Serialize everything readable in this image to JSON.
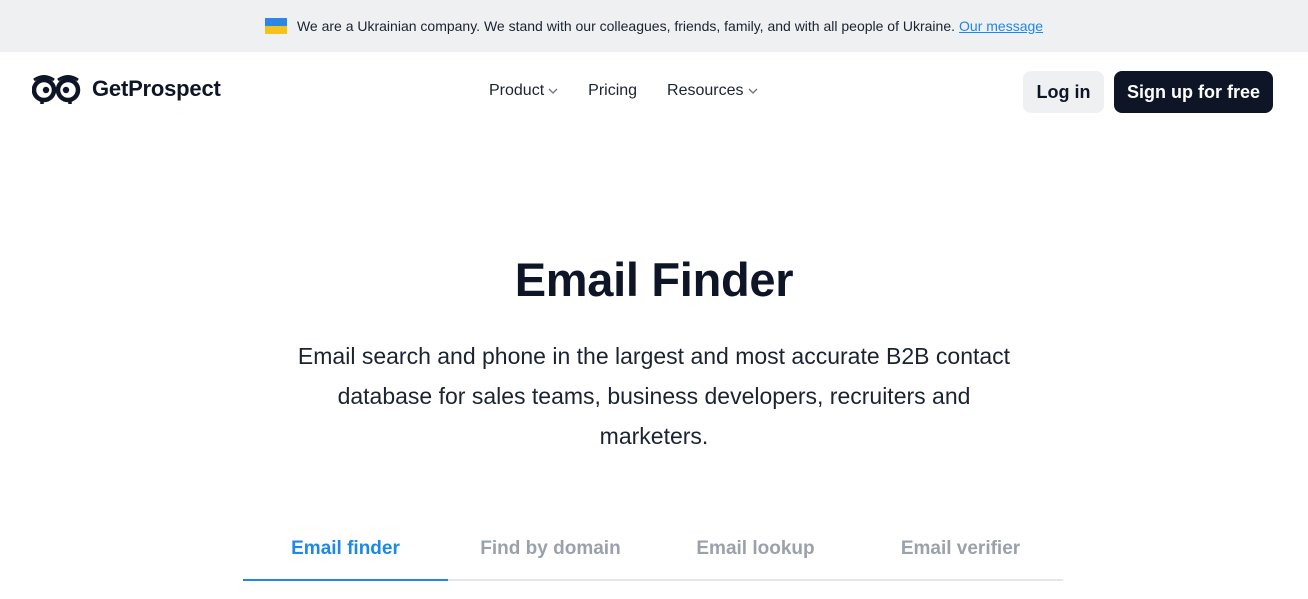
{
  "banner": {
    "message": "We are a Ukrainian company. We stand with our colleagues, friends, family, and with all people of Ukraine.",
    "link_label": "Our message",
    "flag_colors": [
      "#2e86e6",
      "#f4c21c"
    ]
  },
  "header": {
    "logo_text": "GetProspect",
    "logo_icon": "owl-eyes-icon",
    "nav": [
      {
        "label": "Product",
        "has_dropdown": true
      },
      {
        "label": "Pricing",
        "has_dropdown": false
      },
      {
        "label": "Resources",
        "has_dropdown": true
      }
    ],
    "login_label": "Log in",
    "signup_label": "Sign up for free"
  },
  "hero": {
    "title": "Email Finder",
    "subtitle": "Email search and phone in the largest and most accurate B2B contact database for sales teams, business developers, recruiters and marketers."
  },
  "tabs": {
    "items": [
      {
        "label": "Email finder",
        "active": true
      },
      {
        "label": "Find by domain",
        "active": false
      },
      {
        "label": "Email lookup",
        "active": false
      },
      {
        "label": "Email verifier",
        "active": false
      }
    ]
  },
  "colors": {
    "accent": "#1e88e5",
    "dark": "#0d1526",
    "banner_bg": "#eef0f2"
  }
}
